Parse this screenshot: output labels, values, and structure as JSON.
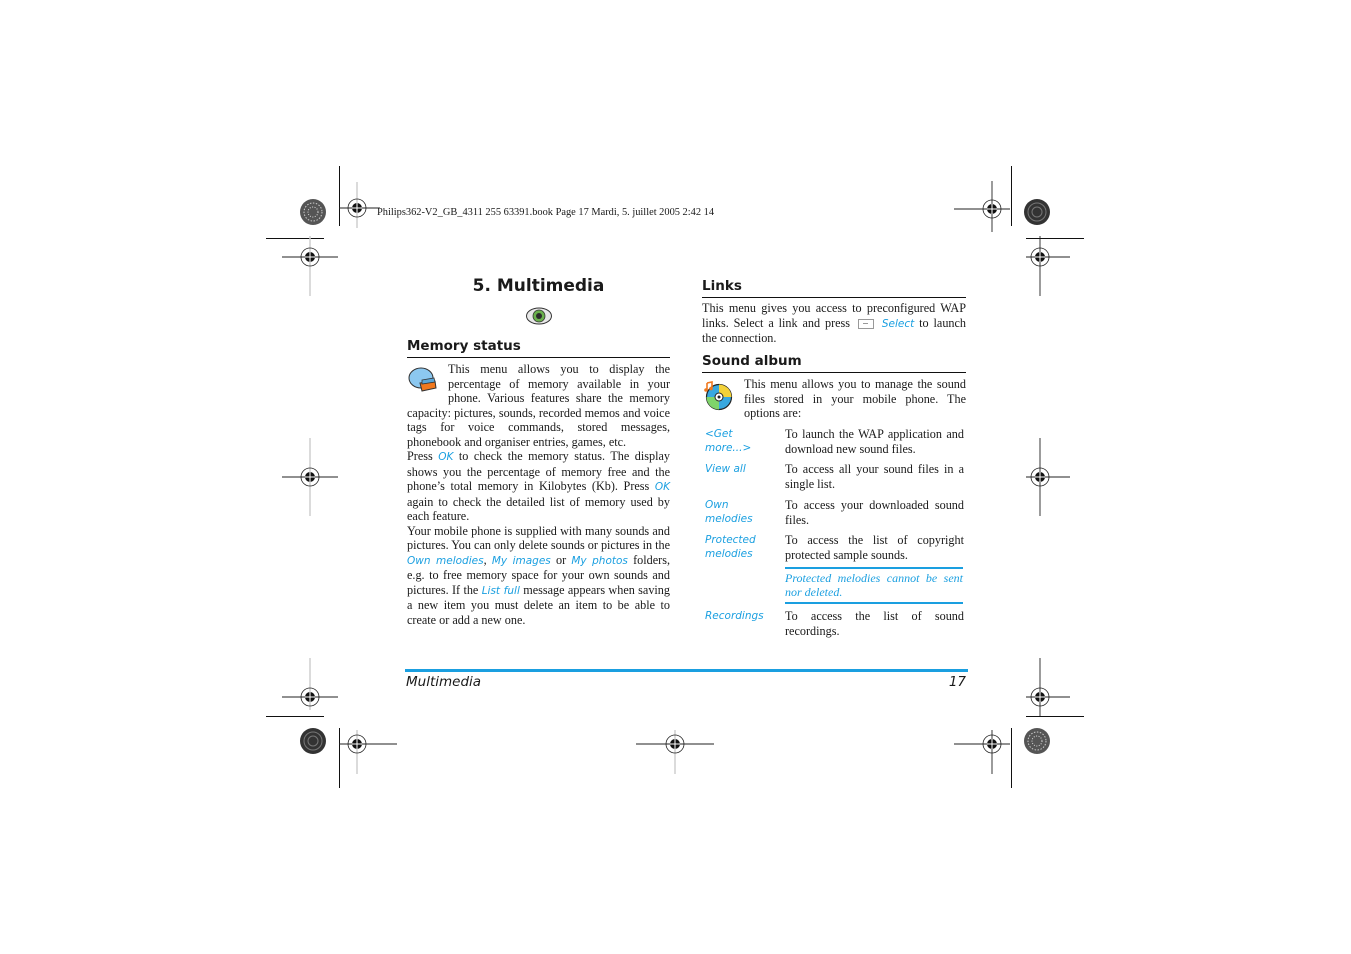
{
  "print_header": "Philips362-V2_GB_4311 255 63391.book  Page 17  Mardi, 5. juillet 2005  2:42 14",
  "chapter": {
    "title": "5. Multimedia",
    "icon": "multimedia-eye-icon"
  },
  "memory_status": {
    "heading": "Memory status",
    "icon": "memory-pie-chart-icon",
    "para1": "This menu allows you to display the percentage of memory available in your phone. Various features share the memory capacity: pictures, sounds, recorded memos and voice tags for voice commands, stored messages, phonebook and organiser entries, games, etc.",
    "para2_pre": "Press ",
    "para2_ok1": "OK",
    "para2_mid": " to check the memory status. The display shows you the percentage of memory free and the phone’s total memory in Kilobytes (Kb). Press ",
    "para2_ok2": "OK",
    "para2_post": " again to check the detailed list of memory used by each feature.",
    "para3_pre": "Your mobile phone is supplied with many sounds and pictures. You can only delete sounds or pictures in the ",
    "para3_link1": "Own melodies",
    "para3_sep1": ", ",
    "para3_link2": "My images",
    "para3_sep2": " or ",
    "para3_link3": "My photos",
    "para3_mid": " folders, e.g. to free memory space for your own sounds and pictures. If the ",
    "para3_link4": "List full",
    "para3_post": " message appears when saving a new item you must delete an item to be able to create or add a new one."
  },
  "links": {
    "heading": "Links",
    "text_pre": "This menu gives you access to preconfigured WAP links. Select a link and press ",
    "key_icon": "softkey-icon",
    "select_label": "Select",
    "text_post": " to launch the connection."
  },
  "sound_album": {
    "heading": "Sound album",
    "icon": "music-cd-icon",
    "intro": "This menu allows you to manage the sound files stored in your mobile phone. The options are:",
    "options": [
      {
        "term": "<Get more...>",
        "desc": "To launch the WAP application and download new sound files."
      },
      {
        "term": "View all",
        "desc": "To access all your sound files in a single list."
      },
      {
        "term": "Own melodies",
        "desc": "To access your downloaded sound files."
      },
      {
        "term": "Protected melodies",
        "desc": "To access the list of copyright protected sample sounds."
      },
      {
        "term": "Recordings",
        "desc": "To access the list of sound recordings."
      }
    ],
    "note": "Protected melodies cannot be sent nor deleted."
  },
  "footer": {
    "section": "Multimedia",
    "page": "17"
  },
  "colors": {
    "accent": "#1a9fe0",
    "text": "#1a1a1a"
  }
}
